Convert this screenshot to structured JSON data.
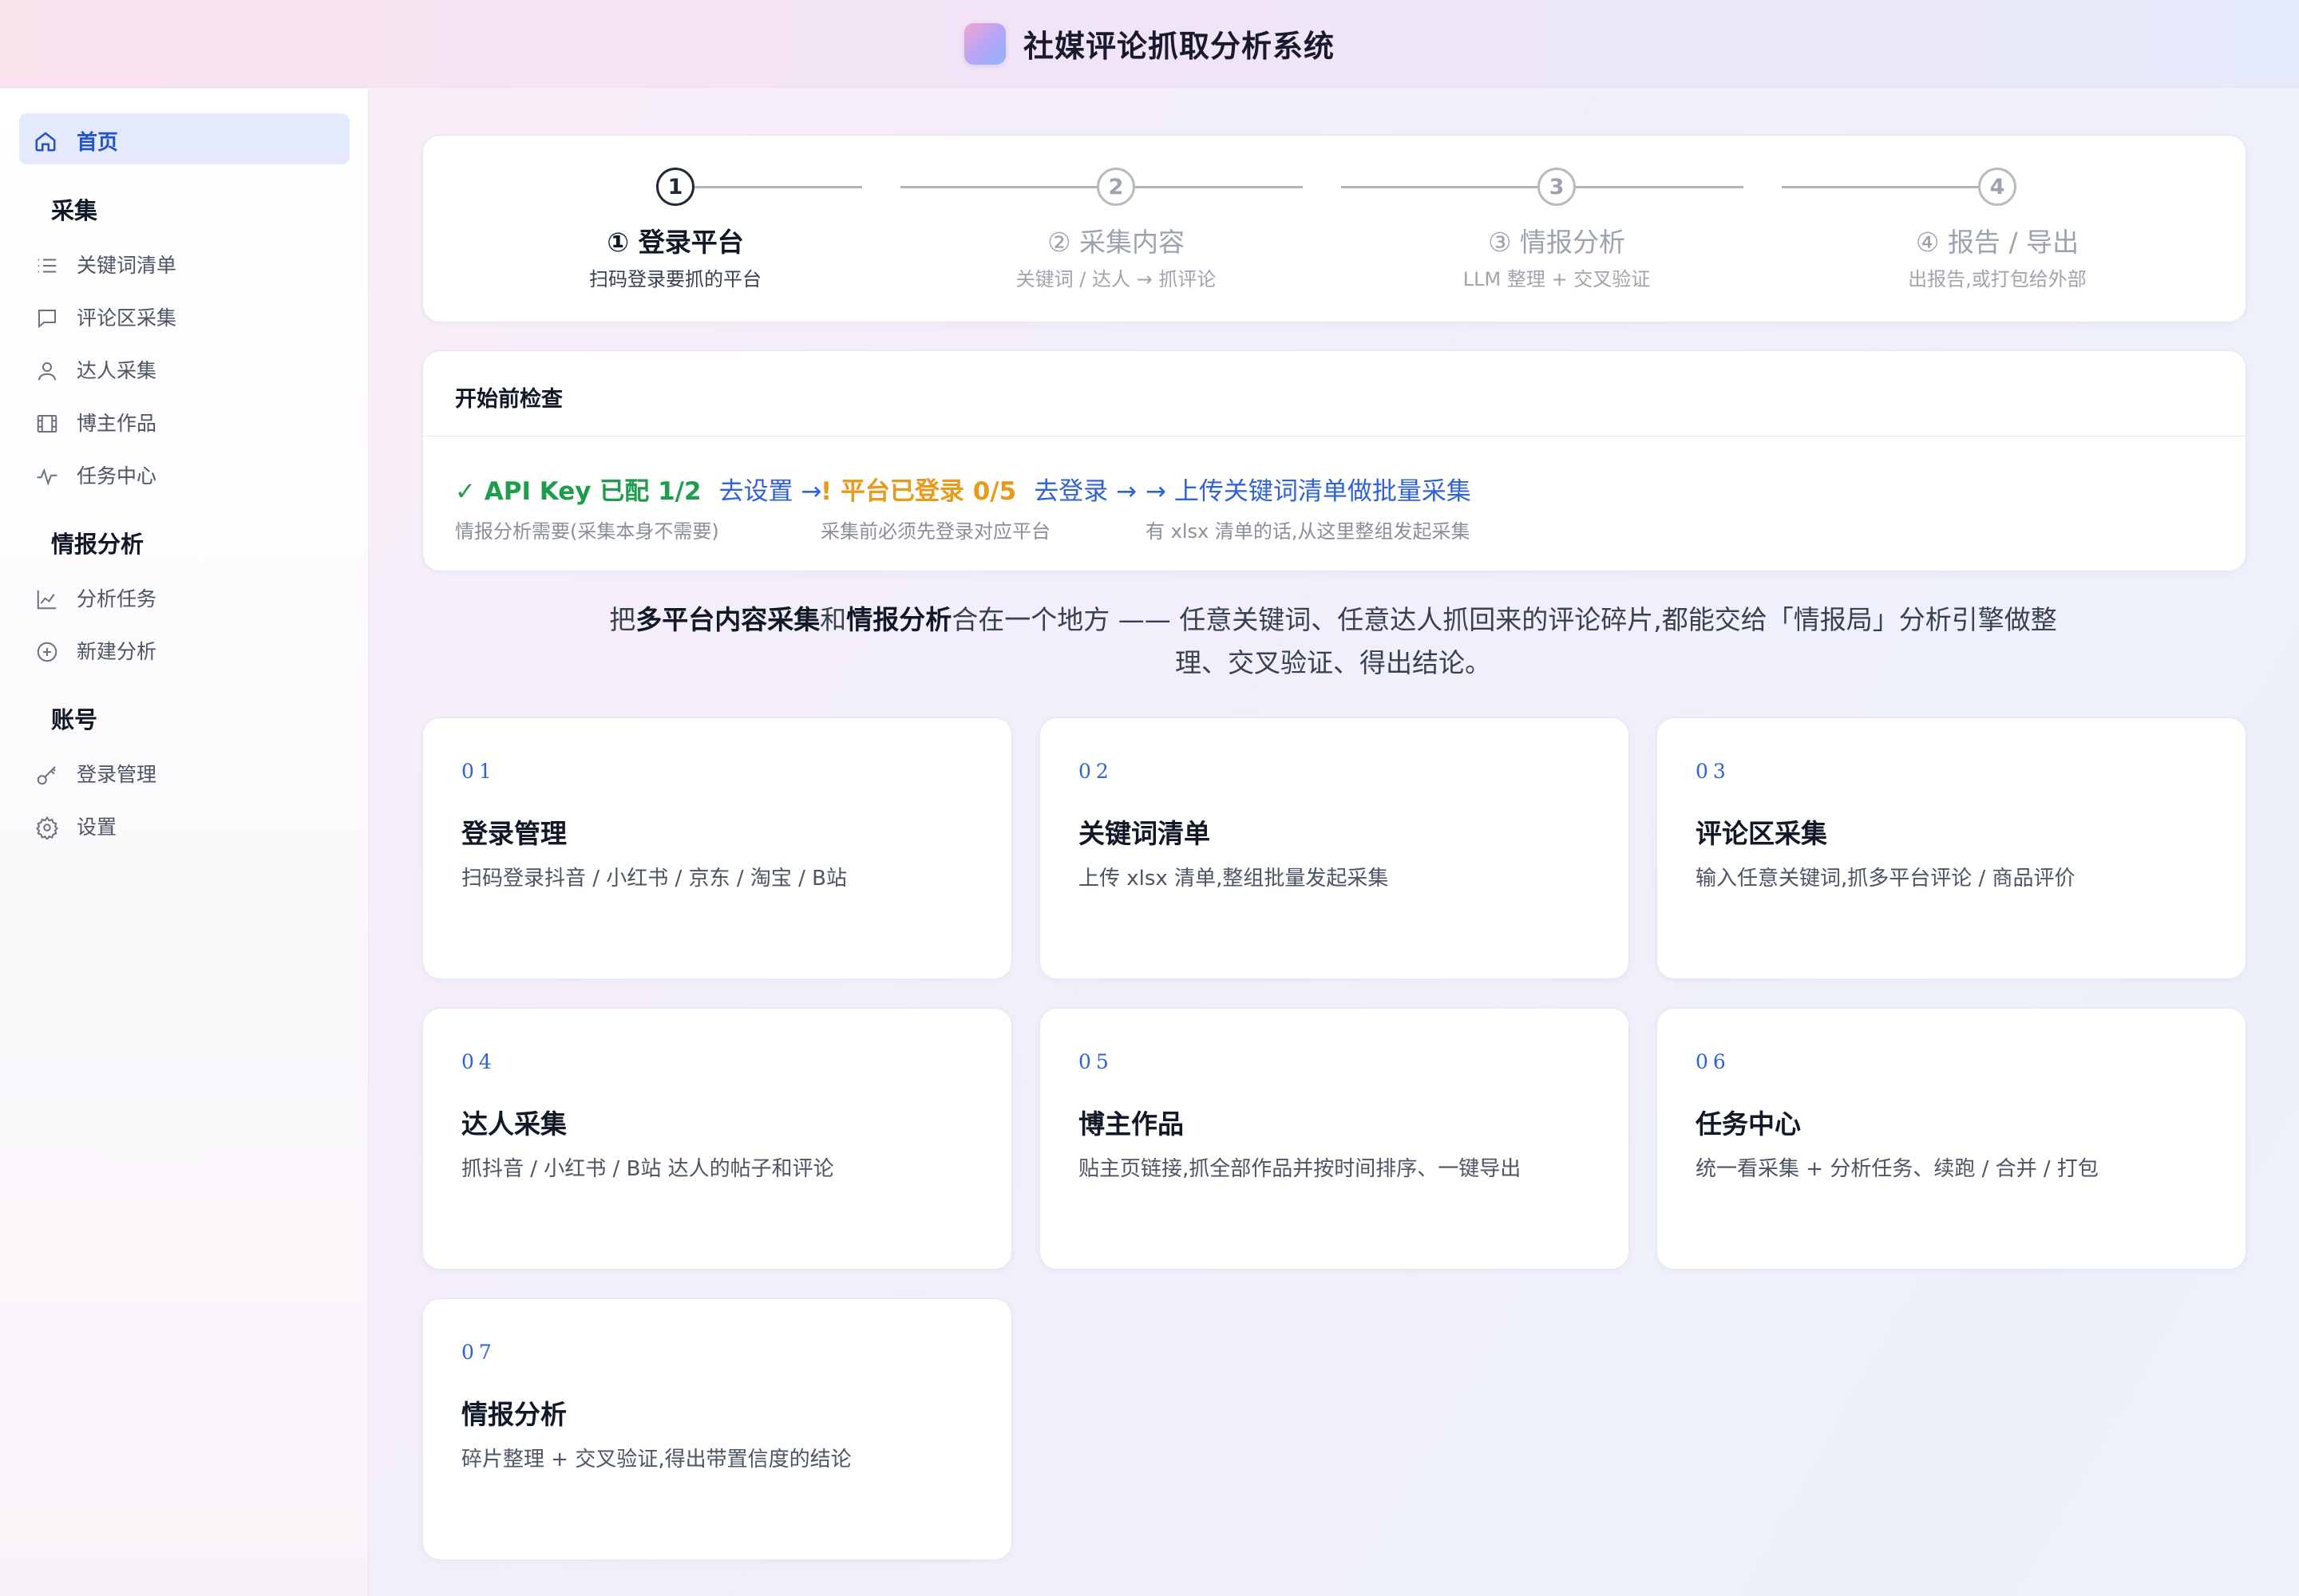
{
  "app": {
    "title": "社媒评论抓取分析系统"
  },
  "sidebar": {
    "home": "首页",
    "sections": [
      {
        "title": "采集",
        "items": [
          "关键词清单",
          "评论区采集",
          "达人采集",
          "博主作品",
          "任务中心"
        ]
      },
      {
        "title": "情报分析",
        "items": [
          "分析任务",
          "新建分析"
        ]
      },
      {
        "title": "账号",
        "items": [
          "登录管理",
          "设置"
        ]
      }
    ]
  },
  "stepper": {
    "steps": [
      {
        "num": "1",
        "title": "① 登录平台",
        "sub": "扫码登录要抓的平台",
        "active": true
      },
      {
        "num": "2",
        "title": "② 采集内容",
        "sub": "关键词 / 达人 → 抓评论",
        "active": false
      },
      {
        "num": "3",
        "title": "③ 情报分析",
        "sub": "LLM 整理 + 交叉验证",
        "active": false
      },
      {
        "num": "4",
        "title": "④ 报告 / 导出",
        "sub": "出报告,或打包给外部",
        "active": false
      }
    ]
  },
  "precheck": {
    "title": "开始前检查",
    "items": [
      {
        "status": "✓ API Key 已配 1/2",
        "link": "去设置 →",
        "desc": "情报分析需要(采集本身不需要)",
        "level": "ok"
      },
      {
        "status": "! 平台已登录 0/5",
        "link": "去登录 →",
        "desc": "采集前必须先登录对应平台",
        "level": "warn"
      },
      {
        "status": "",
        "link": "→ 上传关键词清单做批量采集",
        "desc": "有 xlsx 清单的话,从这里整组发起采集",
        "level": "info"
      }
    ]
  },
  "intro": {
    "p1": "把",
    "b1": "多平台内容采集",
    "p2": "和",
    "b2": "情报分析",
    "p3": "合在一个地方 —— 任意关键词、任意达人抓回来的评论碎片,都能交给「情报局」分析引擎做整理、交叉验证、得出结论。"
  },
  "features": [
    {
      "num": "01",
      "title": "登录管理",
      "desc": "扫码登录抖音 / 小红书 / 京东 / 淘宝 / B站"
    },
    {
      "num": "02",
      "title": "关键词清单",
      "desc": "上传 xlsx 清单,整组批量发起采集"
    },
    {
      "num": "03",
      "title": "评论区采集",
      "desc": "输入任意关键词,抓多平台评论 / 商品评价"
    },
    {
      "num": "04",
      "title": "达人采集",
      "desc": "抓抖音 / 小红书 / B站 达人的帖子和评论"
    },
    {
      "num": "05",
      "title": "博主作品",
      "desc": "贴主页链接,抓全部作品并按时间排序、一键导出"
    },
    {
      "num": "06",
      "title": "任务中心",
      "desc": "统一看采集 + 分析任务、续跑 / 合并 / 打包"
    },
    {
      "num": "07",
      "title": "情报分析",
      "desc": "碎片整理 + 交叉验证,得出带置信度的结论"
    }
  ],
  "colors": {
    "accent": "#2f62d8",
    "ok": "#1f9d4c",
    "warn": "#e89a1c"
  }
}
